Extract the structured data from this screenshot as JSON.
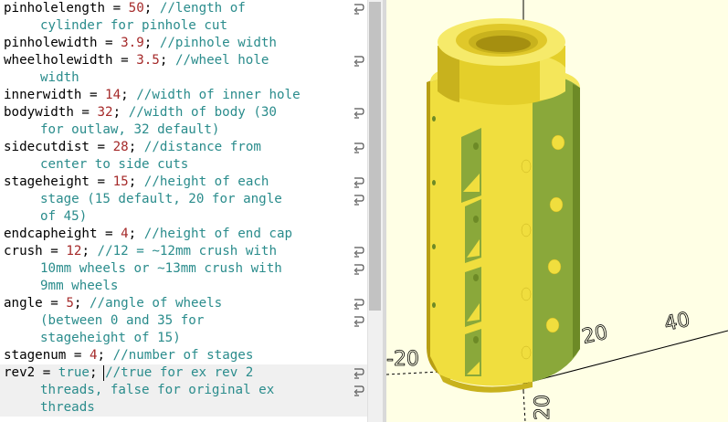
{
  "editor": {
    "lines": [
      {
        "segs": [
          {
            "t": "pinholelength = "
          },
          {
            "t": "50",
            "c": "num"
          },
          {
            "t": "; "
          },
          {
            "t": "//length of",
            "c": "cmt"
          }
        ],
        "wrap": true
      },
      {
        "segs": [
          {
            "t": "cylinder for pinhole cut",
            "c": "cmt"
          }
        ],
        "cont": true
      },
      {
        "segs": [
          {
            "t": "pinholewidth = "
          },
          {
            "t": "3.9",
            "c": "num"
          },
          {
            "t": "; "
          },
          {
            "t": "//pinhole width",
            "c": "cmt"
          }
        ]
      },
      {
        "segs": [
          {
            "t": "wheelholewidth = "
          },
          {
            "t": "3.5",
            "c": "num"
          },
          {
            "t": "; "
          },
          {
            "t": "//wheel hole",
            "c": "cmt"
          }
        ],
        "wrap": true
      },
      {
        "segs": [
          {
            "t": "width",
            "c": "cmt"
          }
        ],
        "cont": true
      },
      {
        "segs": [
          {
            "t": "innerwidth = "
          },
          {
            "t": "14",
            "c": "num"
          },
          {
            "t": "; "
          },
          {
            "t": "//width of inner hole",
            "c": "cmt"
          }
        ]
      },
      {
        "segs": [
          {
            "t": "bodywidth = "
          },
          {
            "t": "32",
            "c": "num"
          },
          {
            "t": "; "
          },
          {
            "t": "//width of body (30",
            "c": "cmt"
          }
        ],
        "wrap": true
      },
      {
        "segs": [
          {
            "t": "for outlaw, 32 default)",
            "c": "cmt"
          }
        ],
        "cont": true
      },
      {
        "segs": [
          {
            "t": "sidecutdist = "
          },
          {
            "t": "28",
            "c": "num"
          },
          {
            "t": "; "
          },
          {
            "t": "//distance from",
            "c": "cmt"
          }
        ],
        "wrap": true
      },
      {
        "segs": [
          {
            "t": "center to side cuts",
            "c": "cmt"
          }
        ],
        "cont": true
      },
      {
        "segs": [
          {
            "t": "stageheight = "
          },
          {
            "t": "15",
            "c": "num"
          },
          {
            "t": "; "
          },
          {
            "t": "//height of each",
            "c": "cmt"
          }
        ],
        "wrap": true
      },
      {
        "segs": [
          {
            "t": "stage (15 default, 20 for angle",
            "c": "cmt"
          }
        ],
        "cont": true,
        "wrap": true
      },
      {
        "segs": [
          {
            "t": "of 45)",
            "c": "cmt"
          }
        ],
        "cont": true
      },
      {
        "segs": [
          {
            "t": "endcapheight = "
          },
          {
            "t": "4",
            "c": "num"
          },
          {
            "t": "; "
          },
          {
            "t": "//height of end cap",
            "c": "cmt"
          }
        ]
      },
      {
        "segs": [
          {
            "t": "crush = "
          },
          {
            "t": "12",
            "c": "num"
          },
          {
            "t": "; "
          },
          {
            "t": "//12 = ~12mm crush with",
            "c": "cmt"
          }
        ],
        "wrap": true
      },
      {
        "segs": [
          {
            "t": "10mm wheels or ~13mm crush with",
            "c": "cmt"
          }
        ],
        "cont": true,
        "wrap": true
      },
      {
        "segs": [
          {
            "t": "9mm wheels",
            "c": "cmt"
          }
        ],
        "cont": true
      },
      {
        "segs": [
          {
            "t": "angle = "
          },
          {
            "t": "5",
            "c": "num"
          },
          {
            "t": "; "
          },
          {
            "t": "//angle of wheels",
            "c": "cmt"
          }
        ],
        "wrap": true
      },
      {
        "segs": [
          {
            "t": "(between 0 and 35 for",
            "c": "cmt"
          }
        ],
        "cont": true,
        "wrap": true
      },
      {
        "segs": [
          {
            "t": "stageheight of 15)",
            "c": "cmt"
          }
        ],
        "cont": true
      },
      {
        "segs": [
          {
            "t": "stagenum = "
          },
          {
            "t": "4",
            "c": "num"
          },
          {
            "t": "; "
          },
          {
            "t": "//number of stages",
            "c": "cmt"
          }
        ]
      },
      {
        "segs": [
          {
            "t": "rev2 = "
          },
          {
            "t": "true",
            "c": "kw"
          },
          {
            "t": "; "
          },
          {
            "t": "//true for ex rev 2",
            "c": "cmt"
          }
        ],
        "wrap": true,
        "current": true
      },
      {
        "segs": [
          {
            "t": "threads, false for original ex",
            "c": "cmt"
          }
        ],
        "cont": true,
        "wrap": true,
        "current": true
      },
      {
        "segs": [
          {
            "t": "threads",
            "c": "cmt"
          }
        ],
        "cont": true,
        "current": true
      }
    ]
  },
  "viewport": {
    "axis_labels": {
      "x20": "20",
      "x40": "40",
      "y_neg20": "-20",
      "z20": "20",
      "z_bottom": "20"
    },
    "colors": {
      "background": "#ffffe5",
      "yellow": "#f0de3e",
      "yellow_dark": "#c8b21d",
      "green": "#8aa83a",
      "green_dark": "#6d8a26"
    }
  }
}
